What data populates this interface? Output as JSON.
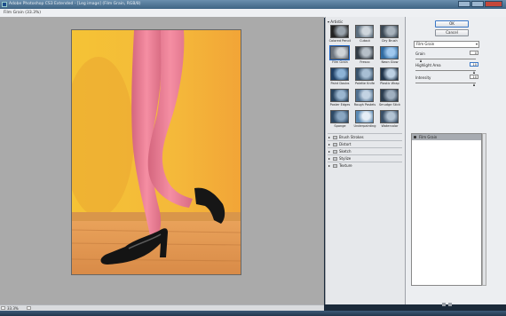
{
  "window": {
    "title": "Adobe Photoshop CS3 Extended - [Leg image] (Film Grain, RGB/8)",
    "doc_title": "Film Grain (33.3%)"
  },
  "gallery": {
    "open_category": "Artistic",
    "filters": [
      {
        "label": "Colored Pencil"
      },
      {
        "label": "Cutout"
      },
      {
        "label": "Dry Brush"
      },
      {
        "label": "Film Grain",
        "selected": true
      },
      {
        "label": "Fresco"
      },
      {
        "label": "Neon Glow"
      },
      {
        "label": "Paint Daubs"
      },
      {
        "label": "Palette Knife"
      },
      {
        "label": "Plastic Wrap"
      },
      {
        "label": "Poster Edges"
      },
      {
        "label": "Rough Pastels"
      },
      {
        "label": "Smudge Stick"
      },
      {
        "label": "Sponge"
      },
      {
        "label": "Underpainting"
      },
      {
        "label": "Watercolor"
      }
    ],
    "categories": [
      "Brush Strokes",
      "Distort",
      "Sketch",
      "Stylize",
      "Texture"
    ]
  },
  "settings": {
    "ok_label": "OK",
    "cancel_label": "Cancel",
    "filter_select": "Film Grain",
    "params": [
      {
        "label": "Grain",
        "value": "0",
        "fraction": 0.1
      },
      {
        "label": "Highlight Area",
        "value": "10",
        "fraction": 0.98
      },
      {
        "label": "Intensity",
        "value": "10",
        "fraction": 0.98
      }
    ]
  },
  "layers": {
    "items": [
      "Film Grain"
    ]
  },
  "status": {
    "zoom": "33.3%"
  },
  "colors": {
    "canvas_bg": "#aaaaaa",
    "selection": "#1b62c4",
    "close_button": "#c4473a"
  },
  "icons": [
    "eye-icon",
    "new-layer-icon",
    "delete-layer-icon",
    "folder-icon",
    "chevron-down-icon"
  ]
}
